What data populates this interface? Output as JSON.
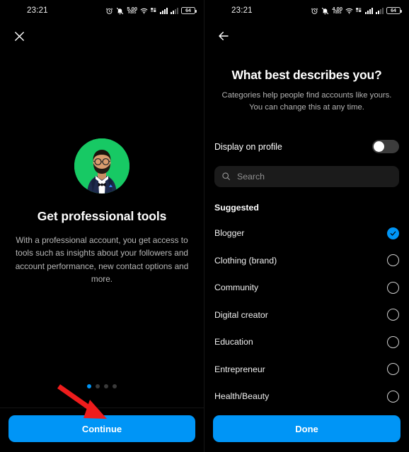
{
  "left": {
    "statusbar": {
      "time": "23:21",
      "data_rate_value": "5.00",
      "data_rate_unit": "KB/S",
      "battery_level": "64",
      "icons": [
        "alarm-icon",
        "bell-muted-icon",
        "data-rate-icon",
        "wifi-icon",
        "sim-signal-icon",
        "signal-bars-icon",
        "signal-bars-secondary-icon",
        "battery-icon"
      ]
    },
    "close_icon": "close-icon",
    "avatar": {
      "name": "profile-avatar",
      "background_color": "#1ed760"
    },
    "title": "Get professional tools",
    "description": "With a professional account, you get access to tools such as insights about your followers and account performance, new contact options and more.",
    "pager": {
      "count": 4,
      "active_index": 0,
      "active_color": "#0095f6",
      "inactive_color": "#3a3a3a"
    },
    "cta_label": "Continue",
    "cta_color": "#0095f6",
    "annotation": {
      "name": "red-arrow-annotation",
      "color": "#ee1c1c"
    }
  },
  "right": {
    "statusbar": {
      "time": "23:21",
      "data_rate_value": "4.00",
      "data_rate_unit": "KB/S",
      "battery_level": "64"
    },
    "back_icon": "back-arrow-icon",
    "title": "What best describes you?",
    "subtitle": "Categories help people find accounts like yours. You can change this at any time.",
    "toggle": {
      "label": "Display on profile",
      "state": "off"
    },
    "search": {
      "placeholder": "Search",
      "value": "",
      "icon": "search-icon"
    },
    "section_label": "Suggested",
    "categories": [
      {
        "label": "Blogger",
        "selected": true
      },
      {
        "label": "Clothing (brand)",
        "selected": false
      },
      {
        "label": "Community",
        "selected": false
      },
      {
        "label": "Digital creator",
        "selected": false
      },
      {
        "label": "Education",
        "selected": false
      },
      {
        "label": "Entrepreneur",
        "selected": false
      },
      {
        "label": "Health/Beauty",
        "selected": false
      }
    ],
    "cta_label": "Done",
    "cta_color": "#0095f6"
  }
}
